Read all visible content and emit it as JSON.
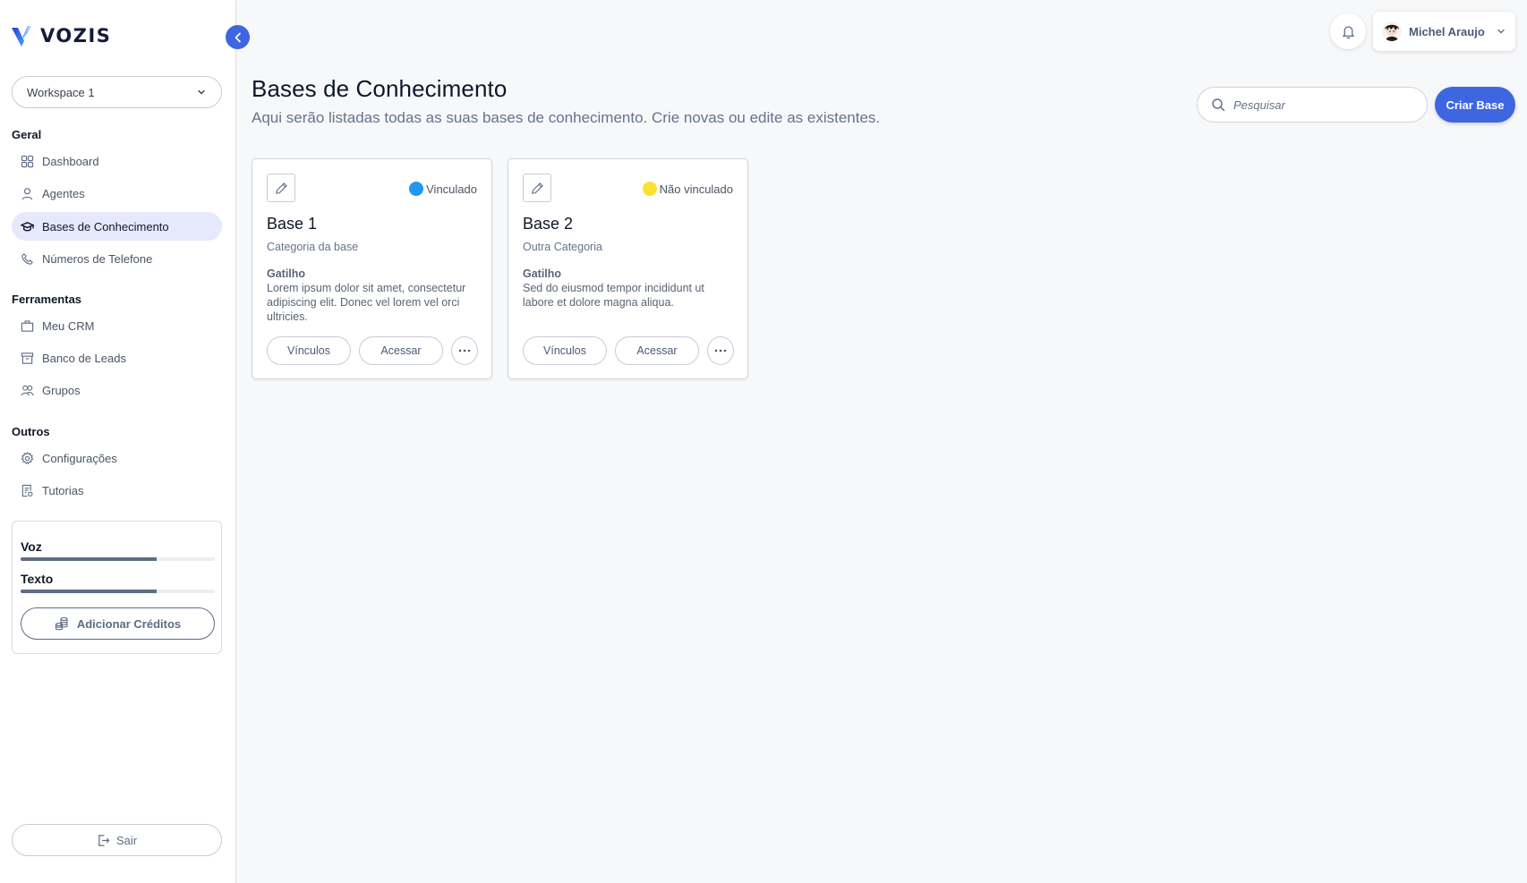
{
  "app": {
    "brand": "VOZIS",
    "brand_color": "#3e66e0"
  },
  "sidebar": {
    "workspace": {
      "selected": "Workspace 1",
      "icon": "chevron-down-icon"
    },
    "sections": [
      {
        "title": "Geral",
        "items": [
          {
            "label": "Dashboard",
            "icon": "grid-icon",
            "active": false
          },
          {
            "label": "Agentes",
            "icon": "user-icon",
            "active": false
          },
          {
            "label": "Bases de Conhecimento",
            "icon": "graduation-cap-icon",
            "active": true
          },
          {
            "label": "Números de Telefone",
            "icon": "phone-icon",
            "active": false
          }
        ]
      },
      {
        "title": "Ferramentas",
        "items": [
          {
            "label": "Meu CRM",
            "icon": "briefcase-icon",
            "active": false
          },
          {
            "label": "Banco de Leads",
            "icon": "archive-icon",
            "active": false
          },
          {
            "label": "Grupos",
            "icon": "users-icon",
            "active": false
          }
        ]
      },
      {
        "title": "Outros",
        "items": [
          {
            "label": "Configurações",
            "icon": "gear-icon",
            "active": false
          },
          {
            "label": "Tutorias",
            "icon": "document-icon",
            "active": false
          }
        ]
      }
    ],
    "credits": {
      "items": [
        {
          "label": "Voz",
          "progress": 0.7
        },
        {
          "label": "Texto",
          "progress": 0.7
        }
      ],
      "add_button": "Adicionar Créditos"
    },
    "logout_label": "Sair"
  },
  "header": {
    "user_name": "Michel Araujo",
    "notifications_icon": "bell-icon"
  },
  "main": {
    "title": "Bases de Conhecimento",
    "subtitle": "Aqui serão listadas todas as suas bases de conhecimento. Crie novas ou edite as existentes.",
    "search_placeholder": "Pesquisar",
    "search_value": "",
    "create_button": "Criar Base",
    "cards": [
      {
        "title": "Base 1",
        "category": "Categoria da base",
        "status": "Vinculado",
        "status_color": "#2196f3",
        "trigger_label": "Gatilho",
        "trigger_text": "Lorem ipsum dolor sit amet, consectetur adipiscing elit. Donec vel lorem vel orci ultricies.",
        "links_button": "Vínculos",
        "access_button": "Acessar"
      },
      {
        "title": "Base 2",
        "category": "Outra Categoria",
        "status": "Não vinculado",
        "status_color": "#fde130",
        "trigger_label": "Gatilho",
        "trigger_text": "Sed do eiusmod tempor incididunt ut labore et dolore magna aliqua.",
        "links_button": "Vínculos",
        "access_button": "Acessar"
      }
    ]
  }
}
